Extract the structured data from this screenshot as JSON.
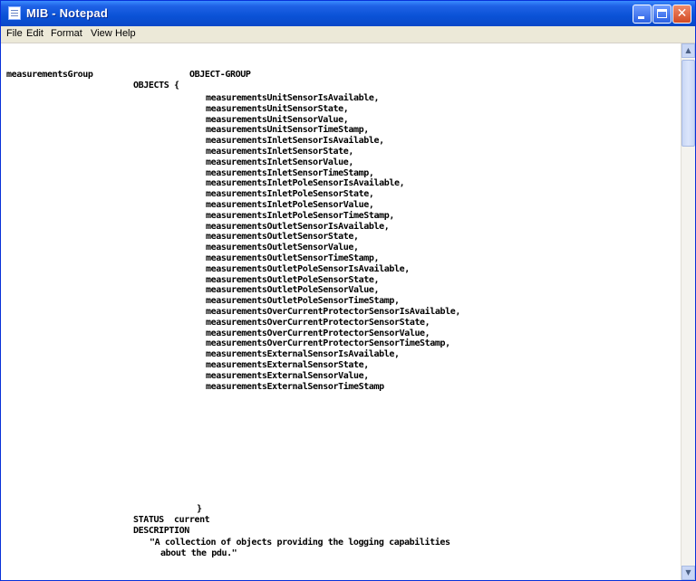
{
  "window": {
    "title": "MIB - Notepad"
  },
  "menu": [
    "File",
    "Edit",
    "Format",
    "View",
    "Help"
  ],
  "document": {
    "group_name": "measurementsGroup",
    "group_type": "OBJECT-GROUP",
    "objects_open": "OBJECTS {",
    "objects": [
      "measurementsUnitSensorIsAvailable,",
      "measurementsUnitSensorState,",
      "measurementsUnitSensorValue,",
      "measurementsUnitSensorTimeStamp,",
      "measurementsInletSensorIsAvailable,",
      "measurementsInletSensorState,",
      "measurementsInletSensorValue,",
      "measurementsInletSensorTimeStamp,",
      "measurementsInletPoleSensorIsAvailable,",
      "measurementsInletPoleSensorState,",
      "measurementsInletPoleSensorValue,",
      "measurementsInletPoleSensorTimeStamp,",
      "measurementsOutletSensorIsAvailable,",
      "measurementsOutletSensorState,",
      "measurementsOutletSensorValue,",
      "measurementsOutletSensorTimeStamp,",
      "measurementsOutletPoleSensorIsAvailable,",
      "measurementsOutletPoleSensorState,",
      "measurementsOutletPoleSensorValue,",
      "measurementsOutletPoleSensorTimeStamp,",
      "measurementsOverCurrentProtectorSensorIsAvailable,",
      "measurementsOverCurrentProtectorSensorState,",
      "measurementsOverCurrentProtectorSensorValue,",
      "measurementsOverCurrentProtectorSensorTimeStamp,",
      "measurementsExternalSensorIsAvailable,",
      "measurementsExternalSensorState,",
      "measurementsExternalSensorValue,",
      "measurementsExternalSensorTimeStamp"
    ],
    "objects_close": "}",
    "status_line": "STATUS  current",
    "description_label": "DESCRIPTION",
    "description_line1": "\"A collection of objects providing the logging capabilities",
    "description_line2": "about the pdu.\""
  }
}
